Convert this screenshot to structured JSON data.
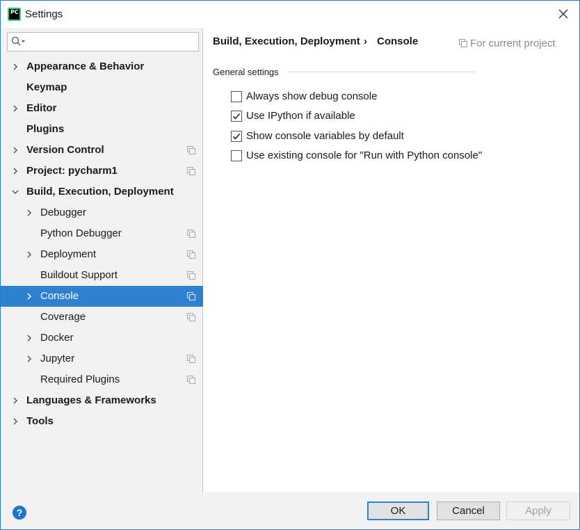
{
  "window": {
    "title": "Settings",
    "app_icon_text": "PC"
  },
  "search": {
    "placeholder": ""
  },
  "tree": [
    {
      "label": "Appearance & Behavior",
      "level": 1,
      "bold": true,
      "chevron": "right",
      "project": false,
      "selected": false
    },
    {
      "label": "Keymap",
      "level": 1,
      "bold": true,
      "chevron": "none",
      "project": false,
      "selected": false
    },
    {
      "label": "Editor",
      "level": 1,
      "bold": true,
      "chevron": "right",
      "project": false,
      "selected": false
    },
    {
      "label": "Plugins",
      "level": 1,
      "bold": true,
      "chevron": "none",
      "project": false,
      "selected": false
    },
    {
      "label": "Version Control",
      "level": 1,
      "bold": true,
      "chevron": "right",
      "project": true,
      "selected": false
    },
    {
      "label": "Project: pycharm1",
      "level": 1,
      "bold": true,
      "chevron": "right",
      "project": true,
      "selected": false
    },
    {
      "label": "Build, Execution, Deployment",
      "level": 1,
      "bold": true,
      "chevron": "down",
      "project": false,
      "selected": false
    },
    {
      "label": "Debugger",
      "level": 2,
      "bold": false,
      "chevron": "right",
      "project": false,
      "selected": false
    },
    {
      "label": "Python Debugger",
      "level": 2,
      "bold": false,
      "chevron": "none",
      "project": true,
      "selected": false
    },
    {
      "label": "Deployment",
      "level": 2,
      "bold": false,
      "chevron": "right",
      "project": true,
      "selected": false
    },
    {
      "label": "Buildout Support",
      "level": 2,
      "bold": false,
      "chevron": "none",
      "project": true,
      "selected": false
    },
    {
      "label": "Console",
      "level": 2,
      "bold": false,
      "chevron": "right",
      "project": true,
      "selected": true
    },
    {
      "label": "Coverage",
      "level": 2,
      "bold": false,
      "chevron": "none",
      "project": true,
      "selected": false
    },
    {
      "label": "Docker",
      "level": 2,
      "bold": false,
      "chevron": "right",
      "project": false,
      "selected": false
    },
    {
      "label": "Jupyter",
      "level": 2,
      "bold": false,
      "chevron": "right",
      "project": true,
      "selected": false
    },
    {
      "label": "Required Plugins",
      "level": 2,
      "bold": false,
      "chevron": "none",
      "project": true,
      "selected": false
    },
    {
      "label": "Languages & Frameworks",
      "level": 1,
      "bold": true,
      "chevron": "right",
      "project": false,
      "selected": false
    },
    {
      "label": "Tools",
      "level": 1,
      "bold": true,
      "chevron": "right",
      "project": false,
      "selected": false
    }
  ],
  "content": {
    "breadcrumb_parent": "Build, Execution, Deployment",
    "breadcrumb_sep": "›",
    "breadcrumb_current": "Console",
    "for_current_project": "For current project",
    "section_title": "General settings",
    "options": [
      {
        "label": "Always show debug console",
        "checked": false
      },
      {
        "label": "Use IPython if available",
        "checked": true
      },
      {
        "label": "Show console variables by default",
        "checked": true
      },
      {
        "label": "Use existing console for \"Run with Python console\"",
        "checked": false
      }
    ]
  },
  "footer": {
    "help": "?",
    "ok": "OK",
    "cancel": "Cancel",
    "apply": "Apply"
  },
  "colors": {
    "accent": "#2e80d0",
    "sidebar_bg": "#f2f2f2",
    "border": "#2b79d0"
  }
}
